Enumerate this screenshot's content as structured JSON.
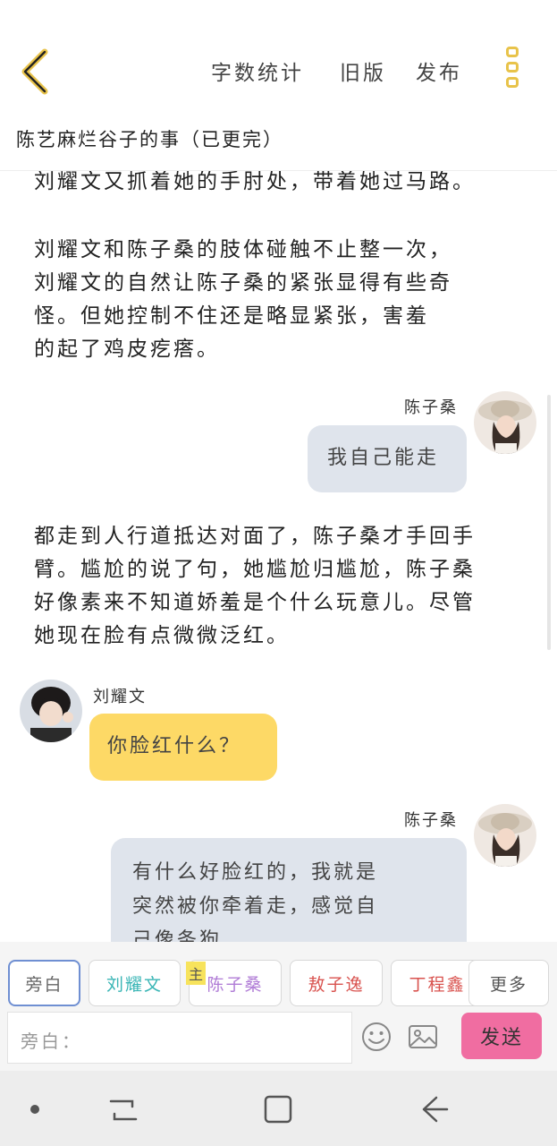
{
  "header": {
    "menu": [
      "字数统计",
      "旧版",
      "发布"
    ],
    "title": "陈艺麻烂谷子的事（已更完）"
  },
  "story": {
    "para1": "刘耀文又抓着她的手肘处，带着她过马路。",
    "para2": "刘耀文和陈子桑的肢体碰触不止整一次，\n刘耀文的自然让陈子桑的紧张显得有些奇\n怪。但她控制不住还是略显紧张，害羞\n的起了鸡皮疙瘩。",
    "msg1": {
      "name": "陈子桑",
      "text": "我自己能走"
    },
    "para3": "都走到人行道抵达对面了，陈子桑才手回手\n臂。尴尬的说了句，她尴尬归尴尬，陈子桑\n好像素来不知道娇羞是个什么玩意儿。尽管\n她现在脸有点微微泛红。",
    "msg2": {
      "name": "刘耀文",
      "text": "你脸红什么？"
    },
    "msg3": {
      "name": "陈子桑",
      "text": "有什么好脸红的，我就是\n突然被你牵着走，感觉自\n己像条狗"
    }
  },
  "chips": {
    "items": [
      {
        "label": "旁白",
        "color": "#666666"
      },
      {
        "label": "刘耀文",
        "color": "#39b5b5"
      },
      {
        "label": "陈子桑",
        "color": "#b07cd6"
      },
      {
        "label": "敖子逸",
        "color": "#d9534f"
      },
      {
        "label": "丁程鑫",
        "color": "#d9534f"
      },
      {
        "label": "更多",
        "color": "#555555"
      }
    ],
    "main_tag": "主"
  },
  "input": {
    "placeholder": "旁白：",
    "send_label": "发送",
    "send_color": "#f06da1"
  },
  "colors": {
    "accent": "#e8c34a",
    "bubble_grey": "#dfe4ec",
    "bubble_yellow": "#fdd966"
  }
}
